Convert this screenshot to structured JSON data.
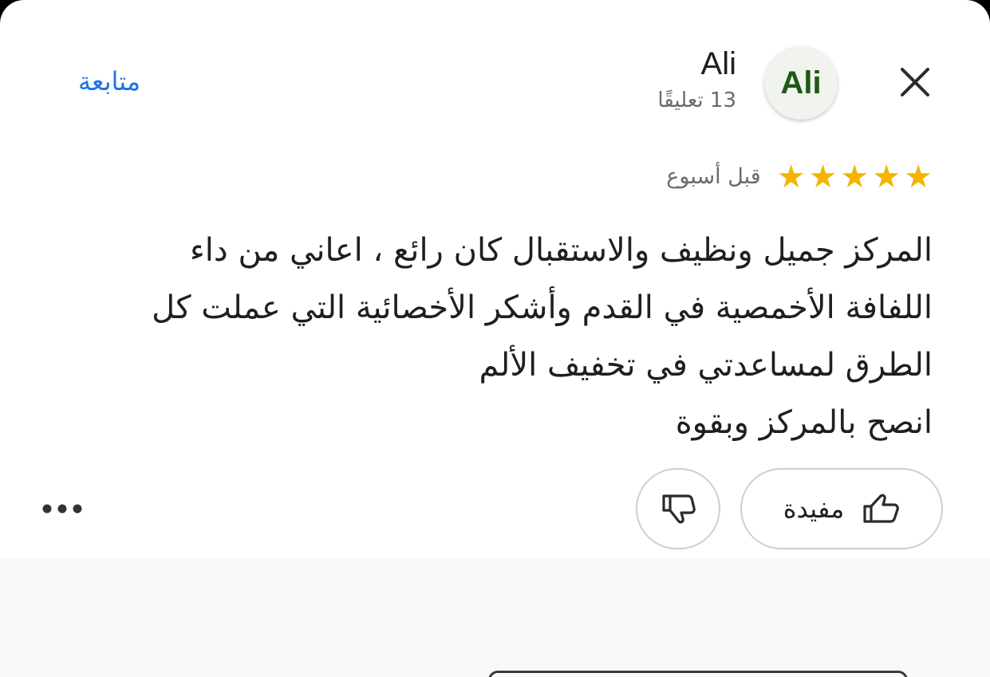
{
  "reviewer": {
    "avatar_text": "Ali",
    "name": "Ali",
    "review_count": "13 تعليقًا"
  },
  "header": {
    "follow_label": "متابعة",
    "close_icon": "close-icon"
  },
  "review": {
    "rating": 5,
    "max_rating": 5,
    "time_ago": "قبل أسبوع",
    "lines": [
      "المركز جميل ونظيف والاستقبال كان رائع  ، اعاني من داء",
      "اللفافة الأخمصية  في القدم وأشكر الأخصائية التي عملت كل",
      "الطرق لمساعدتي في تخفيف الألم",
      "انصح بالمركز وبقوة"
    ]
  },
  "actions": {
    "helpful_label": "مفيدة",
    "helpful_icon": "thumbs-up-icon",
    "dislike_icon": "thumbs-down-icon",
    "more_icon": "more-horizontal-icon"
  },
  "colors": {
    "star": "#f4b400",
    "follow": "#1a73e8",
    "avatar_text": "#1e5a14"
  }
}
